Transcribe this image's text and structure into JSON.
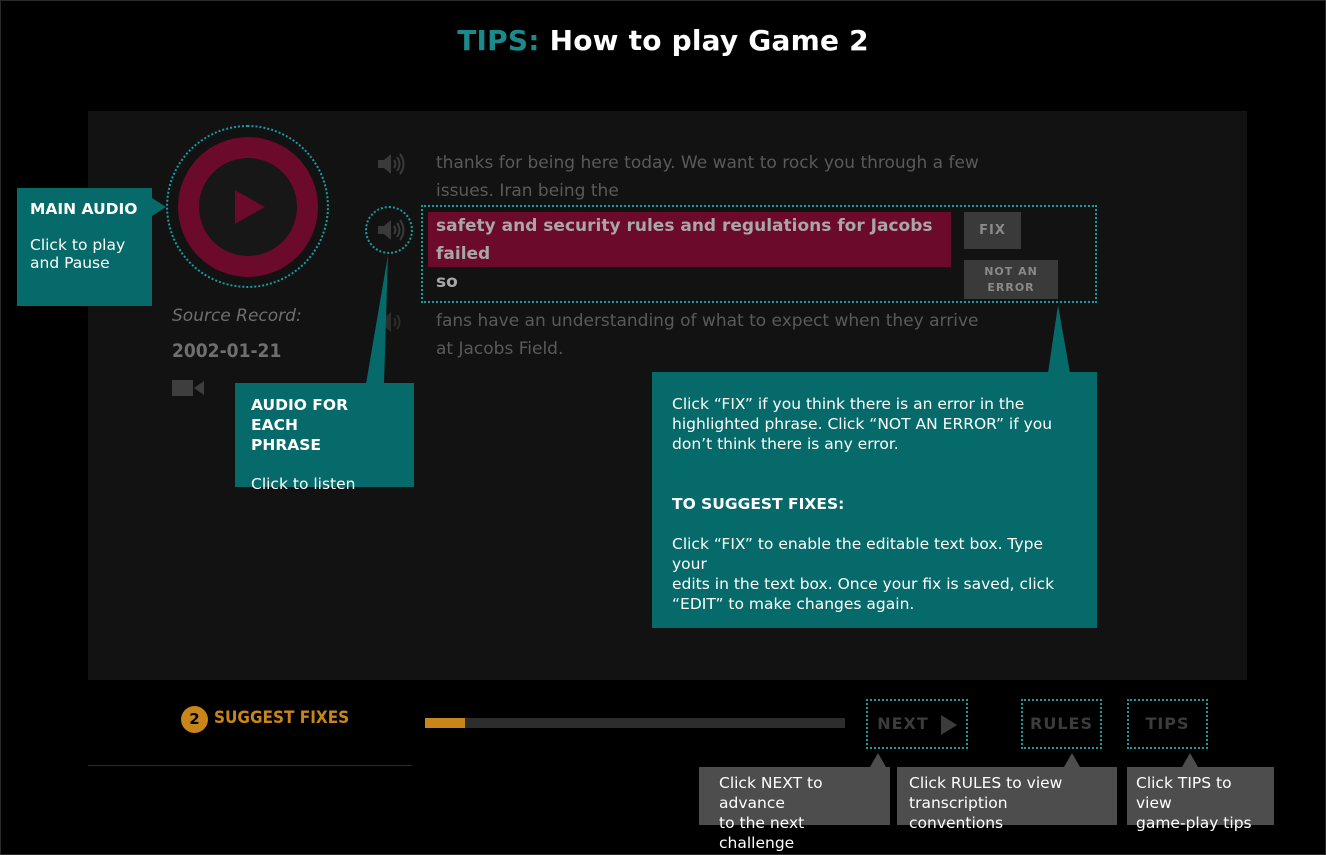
{
  "title": {
    "prefix": "TIPS:",
    "main": "How to play Game 2"
  },
  "source": {
    "label": "Source Record:",
    "date": "2002-01-21"
  },
  "phrases": [
    {
      "line1": "thanks for being here today. We want to rock you through a few",
      "line2": "issues. Iran being the"
    },
    {
      "line1": "safety and security rules and regulations for Jacobs failed",
      "line2": "so"
    },
    {
      "line1": "fans have an understanding of what to expect when they arrive",
      "line2": "at Jacobs Field."
    }
  ],
  "buttons": {
    "fix": "FIX",
    "not_an_error_1": "NOT AN",
    "not_an_error_2": "ERROR"
  },
  "callouts": {
    "main_audio": {
      "title": "MAIN AUDIO",
      "body_1": "Click to play",
      "body_2": "and Pause"
    },
    "phrase_audio": {
      "title_1": "AUDIO FOR EACH",
      "title_2": "PHRASE",
      "body": "Click to listen"
    },
    "fix": {
      "p1_l1": "Click “FIX” if you think there is an error in the",
      "p1_l2": "highlighted phrase. Click “NOT AN ERROR” if you",
      "p1_l3": "don’t think there is any error.",
      "subtitle": "TO SUGGEST FIXES:",
      "p2_l1": "Click “FIX” to enable the editable text box. Type your",
      "p2_l2": "edits in the text box. Once your fix is saved, click",
      "p2_l3": "“EDIT” to make changes again."
    }
  },
  "step": {
    "number": "2",
    "label": "SUGGEST FIXES"
  },
  "progress": {
    "fraction": 0.095
  },
  "nav": {
    "next": "NEXT",
    "rules": "RULES",
    "tips": "TIPS"
  },
  "tips": {
    "next_1": "Click NEXT to advance",
    "next_2": "to the next challenge",
    "rules_1": "Click RULES to view",
    "rules_2": "transcription conventions",
    "tips_1": "Click TIPS to view",
    "tips_2": "game-play tips"
  },
  "colors": {
    "teal": "#066a6a",
    "accent_teal": "#1a8a8c",
    "crimson": "#6b0a2a",
    "gold": "#c8861a"
  }
}
